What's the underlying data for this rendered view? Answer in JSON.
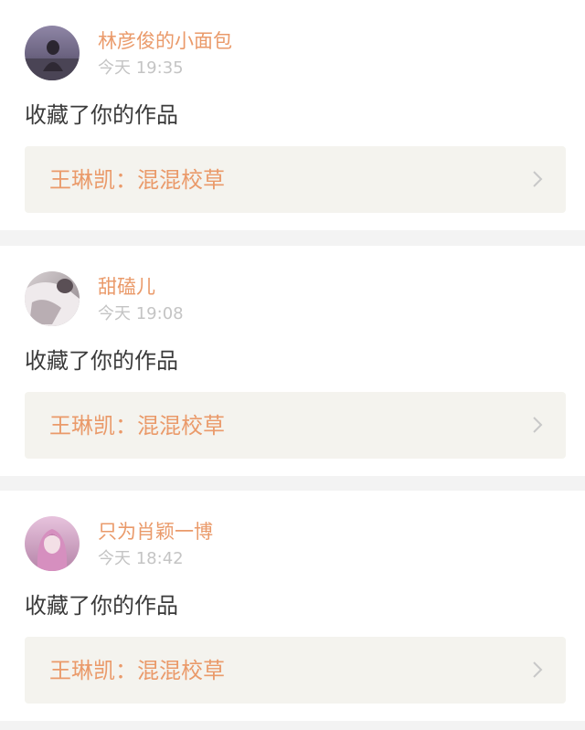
{
  "notifications": [
    {
      "username": "林彦俊的小面包",
      "time": "今天 19:35",
      "action": "收藏了你的作品",
      "work_title": "王琳凯：混混校草"
    },
    {
      "username": "甜磕儿",
      "time": "今天 19:08",
      "action": "收藏了你的作品",
      "work_title": "王琳凯：混混校草"
    },
    {
      "username": "只为肖颖一博",
      "time": "今天 18:42",
      "action": "收藏了你的作品",
      "work_title": "王琳凯：混混校草"
    }
  ],
  "colors": {
    "username": "#ea9a6a",
    "work_title": "#ea9a6a",
    "timestamp": "#c4c4c4",
    "action_text": "#3a3a3a",
    "work_link_bg": "#f4f3ee",
    "separator": "#f3f3f3"
  },
  "icons": {
    "link_arrow": "chevron-right-icon"
  }
}
